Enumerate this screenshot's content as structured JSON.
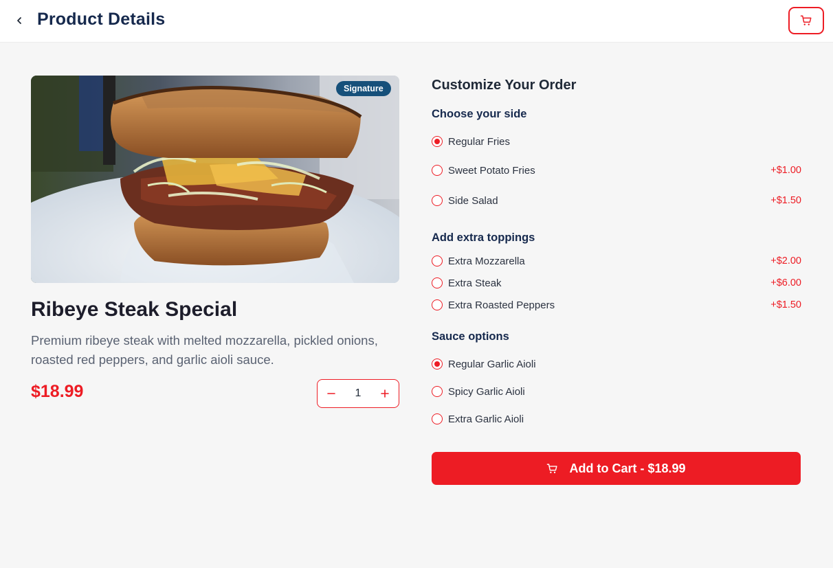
{
  "header": {
    "title": "Product Details"
  },
  "product": {
    "badge": "Signature",
    "name": "Ribeye Steak Special",
    "description": "Premium ribeye steak with melted mozzarella, pickled onions, roasted red peppers, and garlic aioli sauce.",
    "price": "$18.99",
    "quantity": "1"
  },
  "customize": {
    "title": "Customize Your Order",
    "sides": {
      "title": "Choose your side",
      "options": [
        {
          "label": "Regular Fries",
          "price": "",
          "selected": true
        },
        {
          "label": "Sweet Potato Fries",
          "price": "+$1.00",
          "selected": false
        },
        {
          "label": "Side Salad",
          "price": "+$1.50",
          "selected": false
        }
      ]
    },
    "toppings": {
      "title": "Add extra toppings",
      "options": [
        {
          "label": "Extra Mozzarella",
          "price": "+$2.00",
          "selected": false
        },
        {
          "label": "Extra Steak",
          "price": "+$6.00",
          "selected": false
        },
        {
          "label": "Extra Roasted Peppers",
          "price": "+$1.50",
          "selected": false
        }
      ]
    },
    "sauces": {
      "title": "Sauce options",
      "options": [
        {
          "label": "Regular Garlic Aioli",
          "price": "",
          "selected": true
        },
        {
          "label": "Spicy Garlic Aioli",
          "price": "",
          "selected": false
        },
        {
          "label": "Extra Garlic Aioli",
          "price": "",
          "selected": false
        }
      ]
    }
  },
  "add_to_cart": {
    "label": "Add to Cart - $18.99"
  },
  "colors": {
    "accent": "#ed1c24",
    "title_navy": "#16294d",
    "badge": "#16507a",
    "background": "#f6f6f6"
  },
  "icons": [
    "chevron-left-icon",
    "cart-icon",
    "minus-icon",
    "plus-icon"
  ]
}
